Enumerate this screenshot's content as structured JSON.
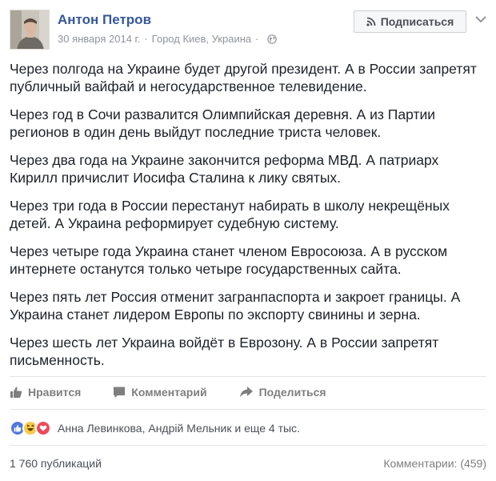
{
  "header": {
    "author": "Антон Петров",
    "date": "30 января 2014 г.",
    "separator": "·",
    "location": "Город Киев, Украина",
    "separator2": "·",
    "subscribe_label": "Подписаться"
  },
  "post": {
    "paragraphs": [
      "Через полгода на Украине будет другой президент. А в России запретят публичный вайфай и негосударственное телевидение.",
      "Через год в Сочи развалится Олимпийская деревня. А из Партии регионов в один день выйдут последние триста человек.",
      "Через два года на Украине закончится реформа МВД. А патриарх Кирилл причислит Иосифа Сталина к лику святых.",
      "Через три года в России перестанут набирать в школу некрещёных детей. А Украина реформирует судебную систему.",
      "Через четыре года Украина станет членом Евросоюза. А в русском интернете останутся только четыре государственных сайта.",
      "Через пять лет Россия отменит загранпаспорта и закроет границы. А Украина станет лидером Европы по экспорту свинины и зерна.",
      "Через шесть лет Украина войдёт в Еврозону. А в России запретят письменность."
    ]
  },
  "actions": {
    "like": "Нравится",
    "comment": "Комментарий",
    "share": "Поделиться"
  },
  "reactions": {
    "names": "Анна Левинкова, Андрій Мельник и еще 4 тыс."
  },
  "footer": {
    "shares": "1 760 публикаций",
    "comments": "Комментарии: (459)"
  },
  "colors": {
    "link": "#365899",
    "text": "#1d2129",
    "muted": "#90949c"
  }
}
